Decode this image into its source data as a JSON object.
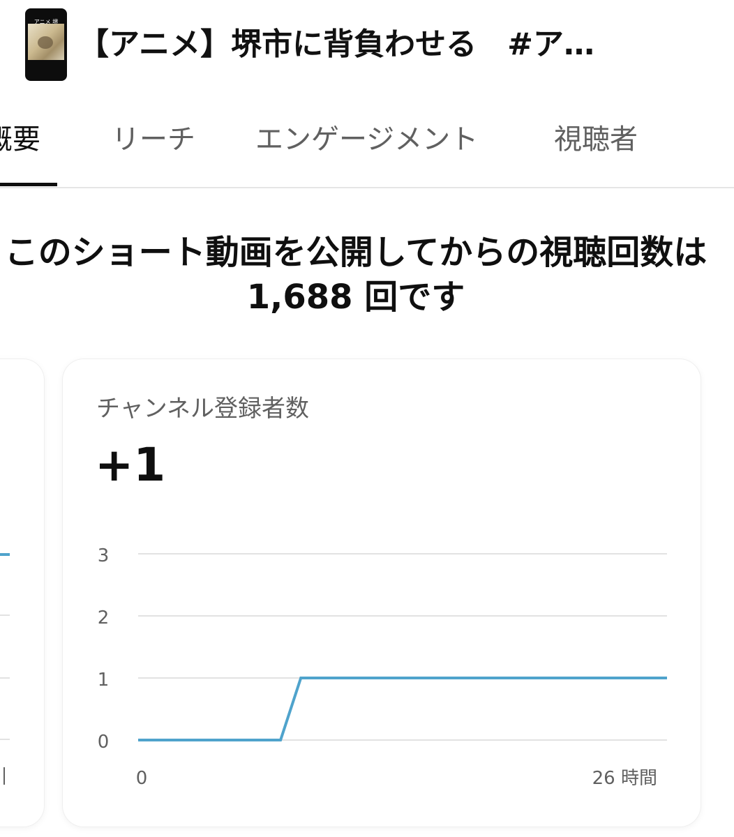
{
  "header": {
    "thumbnail_caption": "アニメ 堺",
    "title": "【アニメ】堺市に背負わせる　#ア…"
  },
  "tabs": [
    {
      "label": "概要",
      "active": true
    },
    {
      "label": "リーチ",
      "active": false
    },
    {
      "label": "エンゲージメント",
      "active": false
    },
    {
      "label": "視聴者",
      "active": false
    }
  ],
  "headline": "このショート動画を公開してからの視聴回数は 1,688 回です",
  "card": {
    "title": "チャンネル登録者数",
    "value": "+1"
  },
  "chart_data": {
    "type": "line",
    "x_start_label": "0",
    "x_end_label": "26 時間",
    "x": [
      0,
      7,
      8,
      26
    ],
    "xlim": [
      0,
      26
    ],
    "series": [
      {
        "values": [
          0,
          0,
          1,
          1
        ]
      }
    ],
    "y_ticks": [
      0,
      1,
      2,
      3
    ],
    "ylim": [
      0,
      3
    ],
    "grid": true,
    "line_color": "#4fa3cc",
    "grid_color": "#e2e2e2"
  }
}
